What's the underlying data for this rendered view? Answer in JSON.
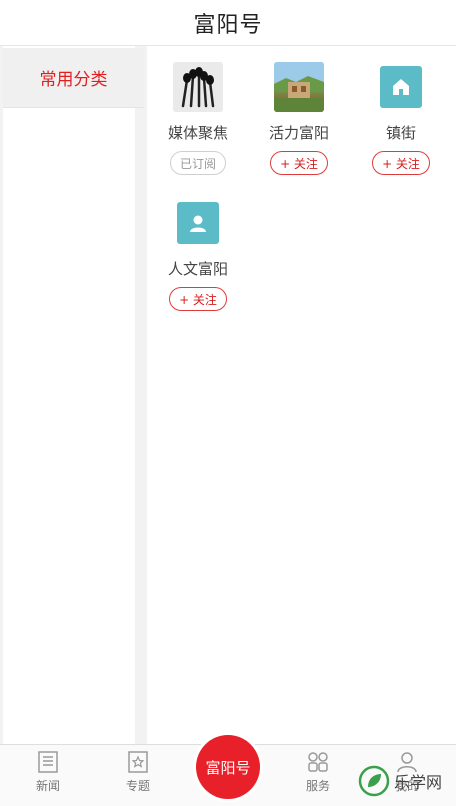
{
  "header": {
    "title": "富阳号"
  },
  "sidebar": {
    "active_category": "常用分类"
  },
  "channels": [
    {
      "name": "媒体聚焦",
      "button": "已订阅",
      "subscribed": true,
      "icon": "microphones-photo-icon"
    },
    {
      "name": "活力富阳",
      "button": "+ 关注",
      "subscribed": false,
      "icon": "landscape-photo-icon"
    },
    {
      "name": "镇街",
      "button": "+ 关注",
      "subscribed": false,
      "icon": "house-icon"
    },
    {
      "name": "人文富阳",
      "button": "+ 关注",
      "subscribed": false,
      "icon": "person-icon"
    }
  ],
  "tabs": {
    "news": "新闻",
    "special": "专题",
    "center": "富阳号",
    "service": "服务",
    "mine": "我的"
  },
  "watermark": {
    "text": "乐学网"
  },
  "colors": {
    "accent": "#e8202a",
    "teal": "#5bbbc6"
  }
}
